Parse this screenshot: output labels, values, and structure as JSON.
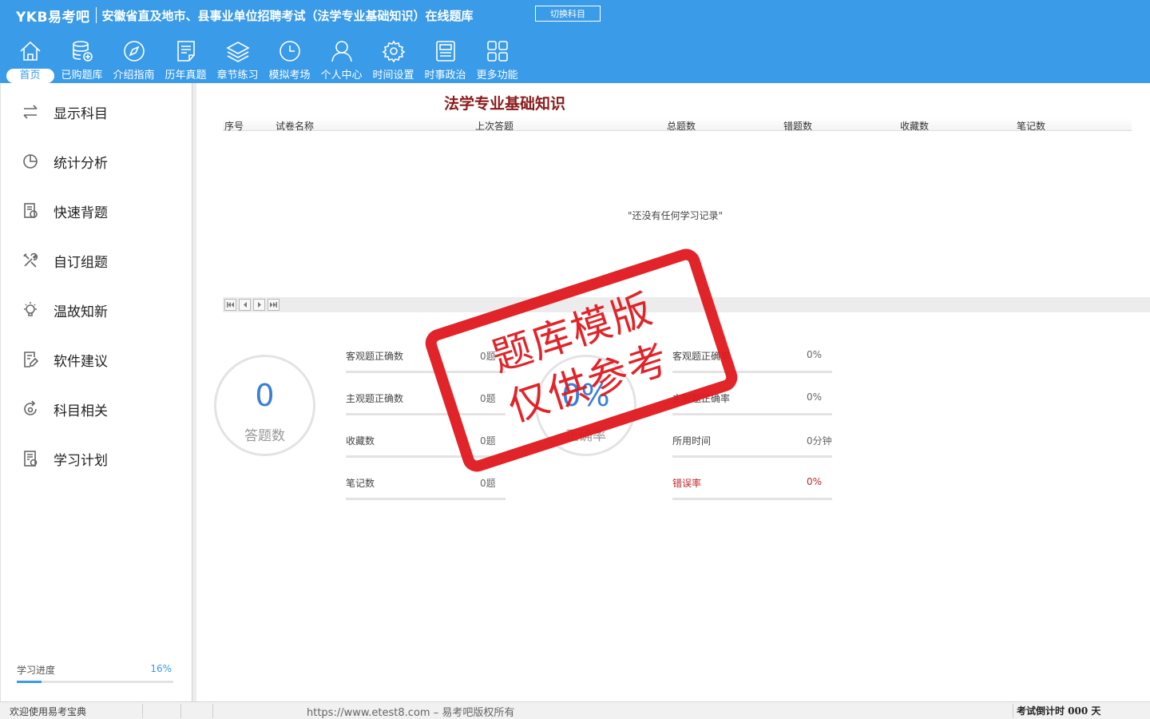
{
  "header": {
    "logo": "YKB易考吧",
    "title": "安徽省直及地市、县事业单位招聘考试（法学专业基础知识）在线题库",
    "switch_button": "切换科目",
    "nav": [
      {
        "label": "首页",
        "icon": "home-icon"
      },
      {
        "label": "已购题库",
        "icon": "database-icon"
      },
      {
        "label": "介绍指南",
        "icon": "compass-icon"
      },
      {
        "label": "历年真题",
        "icon": "document-list-icon"
      },
      {
        "label": "章节练习",
        "icon": "layers-icon"
      },
      {
        "label": "模拟考场",
        "icon": "clock-icon"
      },
      {
        "label": "个人中心",
        "icon": "user-icon"
      },
      {
        "label": "时间设置",
        "icon": "gear-icon"
      },
      {
        "label": "时事政治",
        "icon": "newspaper-icon"
      },
      {
        "label": "更多功能",
        "icon": "grid-icon"
      }
    ]
  },
  "sidebar": {
    "items": [
      {
        "label": "显示科目",
        "icon": "switch-arrows-icon"
      },
      {
        "label": "统计分析",
        "icon": "pie-chart-icon"
      },
      {
        "label": "快速背题",
        "icon": "book-icon"
      },
      {
        "label": "自订组题",
        "icon": "tools-icon"
      },
      {
        "label": "温故知新",
        "icon": "lightbulb-icon"
      },
      {
        "label": "软件建议",
        "icon": "edit-doc-icon"
      },
      {
        "label": "科目相关",
        "icon": "refresh-icon"
      },
      {
        "label": "学习计划",
        "icon": "plan-doc-icon"
      }
    ],
    "progress_label": "学习进度",
    "progress_value": "16%",
    "progress_fraction": 0.16
  },
  "main": {
    "subject_title": "法学专业基础知识",
    "table_headers": [
      "序号",
      "试卷名称",
      "上次答题",
      "总题数",
      "错题数",
      "收藏数",
      "笔记数"
    ],
    "empty_message": "\"还没有任何学习记录\"",
    "answered_count": "0",
    "answered_label": "答题数",
    "accuracy_value": "0%",
    "accuracy_label": "正确率",
    "stats_left": [
      {
        "label": "客观题正确数",
        "value": "0题"
      },
      {
        "label": "主观题正确数",
        "value": "0题"
      },
      {
        "label": "收藏数",
        "value": "0题"
      },
      {
        "label": "笔记数",
        "value": "0题"
      }
    ],
    "stats_right": [
      {
        "label": "客观题正确率",
        "value": "0%"
      },
      {
        "label": "主观题正确率",
        "value": "0%"
      },
      {
        "label": "所用时间",
        "value": "0分钟"
      },
      {
        "label": "错误率",
        "value": "0%"
      }
    ]
  },
  "stamp": {
    "line1": "题库模版",
    "line2": "仅供参考"
  },
  "statusbar": {
    "welcome": "欢迎使用易考宝典",
    "copyright": "https://www.etest8.com – 易考吧版权所有",
    "countdown": "考试倒计时 000 天"
  },
  "colors": {
    "header_bg": "#3a9be8",
    "title_red": "#8b1a1a",
    "stamp_red": "#e0191e",
    "accent_blue": "#3a7fd5"
  }
}
